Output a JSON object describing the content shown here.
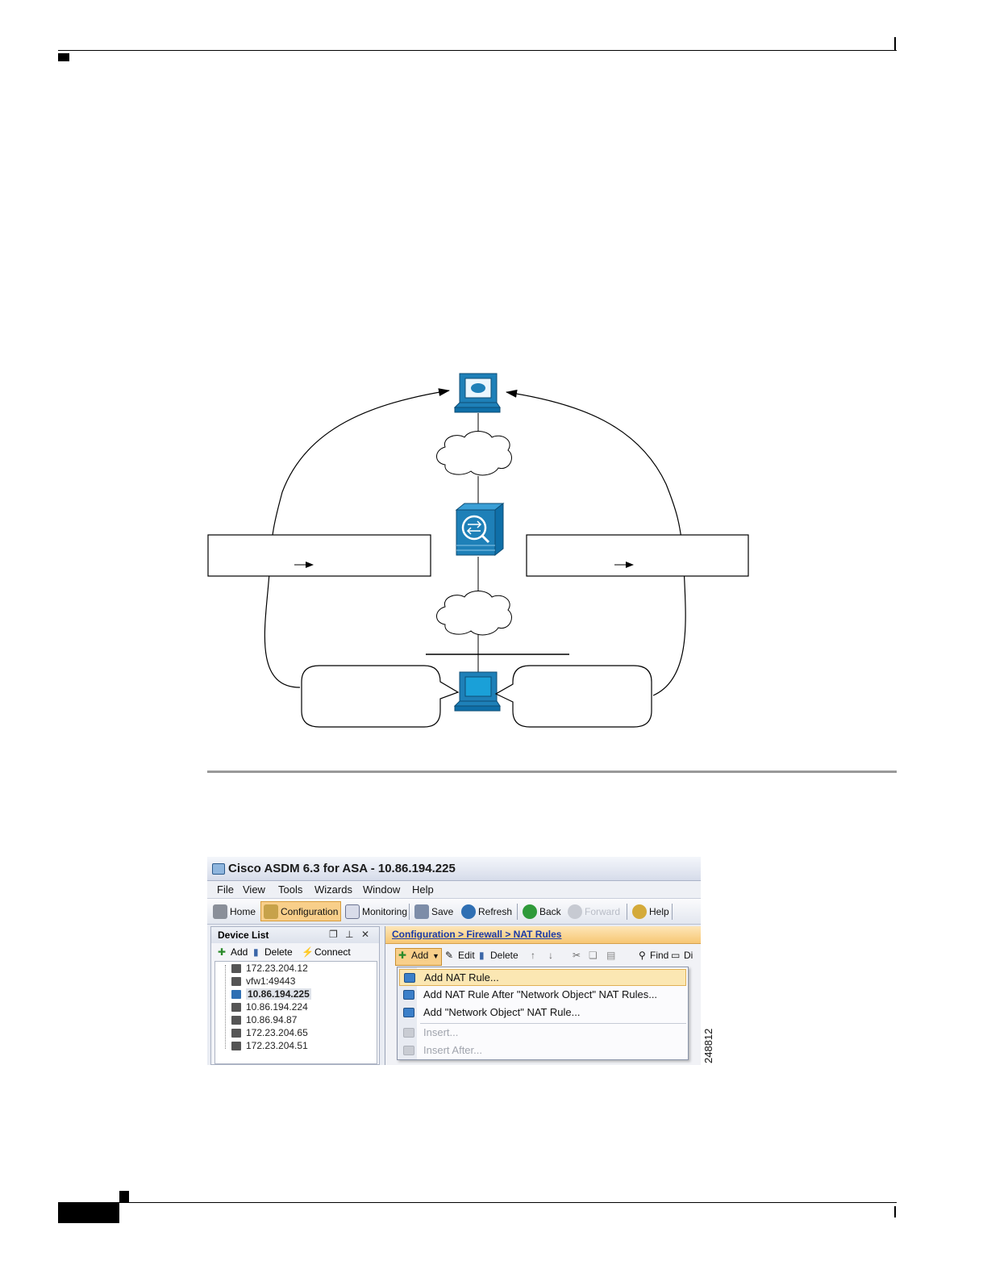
{
  "screenshot": {
    "title": "Cisco ASDM 6.3 for ASA - 10.86.194.225",
    "menu": [
      "File",
      "View",
      "Tools",
      "Wizards",
      "Window",
      "Help"
    ],
    "toolbar": {
      "home": "Home",
      "configuration": "Configuration",
      "monitoring": "Monitoring",
      "save": "Save",
      "refresh": "Refresh",
      "back": "Back",
      "forward": "Forward",
      "help": "Help"
    },
    "device_list": {
      "title": "Device List",
      "add": "Add",
      "delete": "Delete",
      "connect": "Connect",
      "items": [
        "172.23.204.12",
        "vfw1:49443",
        "10.86.194.225",
        "10.86.194.224",
        "10.86.94.87",
        "172.23.204.65",
        "172.23.204.51"
      ],
      "selected": "10.86.194.225"
    },
    "breadcrumb": "Configuration > Firewall > NAT Rules",
    "nat_toolbar": {
      "add": "Add",
      "edit": "Edit",
      "delete": "Delete",
      "find": "Find",
      "diagram": "Di"
    },
    "add_menu": [
      "Add NAT Rule...",
      "Add NAT Rule After \"Network Object\" NAT Rules...",
      "Add \"Network Object\" NAT Rule...",
      "Insert...",
      "Insert After..."
    ],
    "figure_number": "248812"
  }
}
